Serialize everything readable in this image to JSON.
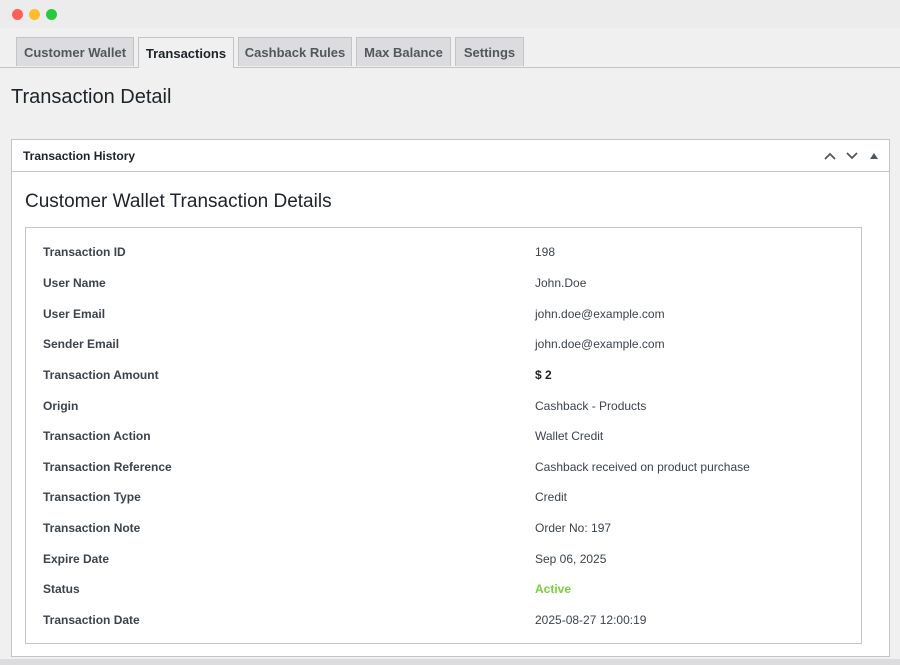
{
  "window": {
    "controls": [
      "close",
      "minimize",
      "maximize"
    ]
  },
  "tabs": [
    {
      "label": "Customer Wallet",
      "active": false
    },
    {
      "label": "Transactions",
      "active": true
    },
    {
      "label": "Cashback Rules",
      "active": false
    },
    {
      "label": "Max Balance",
      "active": false
    },
    {
      "label": "Settings",
      "active": false
    }
  ],
  "page": {
    "title": "Transaction Detail"
  },
  "postbox": {
    "title": "Transaction History",
    "controls": [
      "chevron-up-icon",
      "chevron-down-icon",
      "triangle-up-icon"
    ],
    "heading": "Customer Wallet Transaction Details"
  },
  "details": [
    {
      "label": "Transaction ID",
      "value": "198"
    },
    {
      "label": "User Name",
      "value": "John.Doe"
    },
    {
      "label": "User Email",
      "value": "john.doe@example.com"
    },
    {
      "label": "Sender Email",
      "value": "john.doe@example.com"
    },
    {
      "label": "Transaction Amount",
      "value": "$ 2"
    },
    {
      "label": "Origin",
      "value": "Cashback - Products"
    },
    {
      "label": "Transaction Action",
      "value": "Wallet Credit"
    },
    {
      "label": "Transaction Reference",
      "value": "Cashback received on product purchase"
    },
    {
      "label": "Transaction Type",
      "value": "Credit"
    },
    {
      "label": "Transaction Note",
      "value": "Order No: 197"
    },
    {
      "label": "Expire Date",
      "value": "Sep 06, 2025"
    },
    {
      "label": "Status",
      "value": "Active"
    },
    {
      "label": "Transaction Date",
      "value": "2025-08-27 12:00:19"
    }
  ],
  "colors": {
    "status_active": "#7ad03a",
    "close": "#ff5f57",
    "minimize": "#febc2e",
    "maximize": "#28c840"
  }
}
